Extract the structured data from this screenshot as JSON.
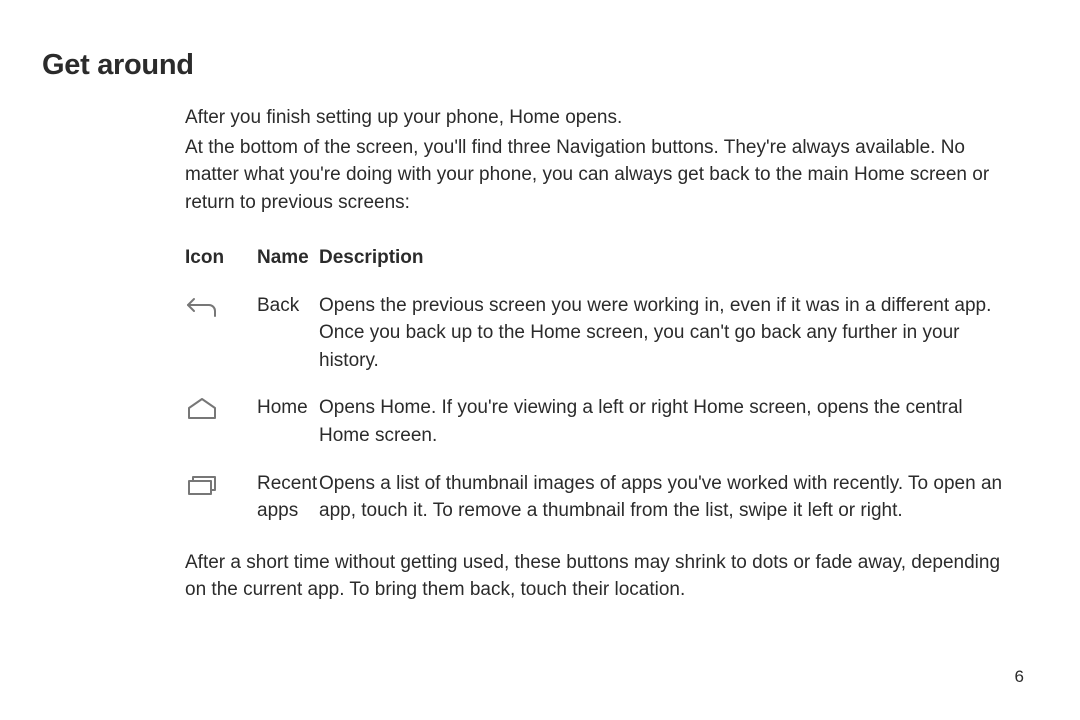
{
  "title": "Get around",
  "lead": "After you finish setting up your phone, Home opens.",
  "intro": "At the bottom of the screen, you'll find three Navigation buttons. They're always available. No matter what you're doing with your phone, you can always get back to the main Home screen or return to previous screens:",
  "headers": {
    "icon": "Icon",
    "name": "Name",
    "desc": "Description"
  },
  "rows": [
    {
      "name": "Back",
      "desc": "Opens the previous screen you were working in, even if it was in a different app. Once you back up to the Home screen, you can't go back any further in your history."
    },
    {
      "name": "Home",
      "desc": "Opens Home. If you're viewing a left or right Home screen, opens the central Home screen."
    },
    {
      "name": "Recent apps",
      "desc": "Opens a list of thumbnail images of apps you've worked with recently. To open an app, touch it. To remove a thumbnail from the list, swipe it left or right."
    }
  ],
  "outro": "After a short time without getting used, these buttons may shrink to dots or fade away, depending on the current app. To bring them back, touch their location.",
  "pageNumber": "6"
}
